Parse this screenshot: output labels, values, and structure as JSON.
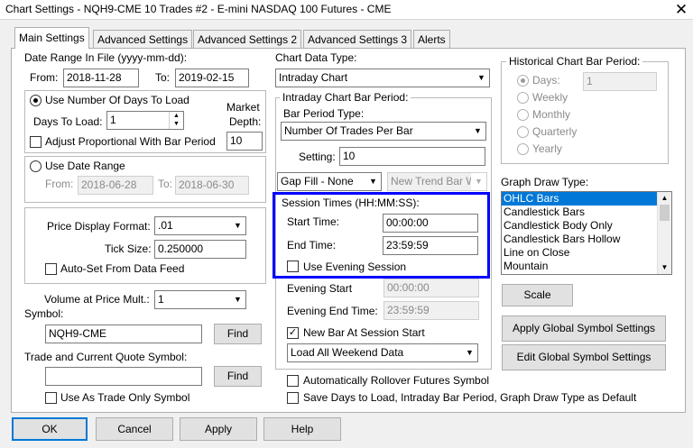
{
  "window": {
    "title": "Chart Settings - NQH9-CME  10 Trades  #2 - E-mini NASDAQ 100 Futures - CME",
    "close_glyph": "✕"
  },
  "tabs": [
    "Main Settings",
    "Advanced Settings",
    "Advanced Settings 2",
    "Advanced Settings 3",
    "Alerts"
  ],
  "date_range": {
    "label": "Date Range In File (yyyy-mm-dd):",
    "from_label": "From:",
    "from_value": "2018-11-28",
    "to_label": "To:",
    "to_value": "2019-02-15"
  },
  "days_group": {
    "use_days_label": "Use Number Of Days To Load",
    "use_days_selected": true,
    "days_to_load_label": "Days To Load:",
    "days_to_load_value": "1",
    "market_depth_label_1": "Market",
    "market_depth_label_2": "Depth:",
    "market_depth_value": "10",
    "adjust_label": "Adjust Proportional With Bar Period",
    "adjust_checked": false
  },
  "date_range_group": {
    "use_date_range_label": "Use Date Range",
    "use_date_range_selected": false,
    "from_label": "From:",
    "from_value": "2018-06-28",
    "to_label": "To:",
    "to_value": "2018-06-30"
  },
  "price_group": {
    "display_format_label": "Price Display Format:",
    "display_format_value": ".01",
    "tick_size_label": "Tick Size:",
    "tick_size_value": "0.250000",
    "auto_set_label": "Auto-Set From Data Feed",
    "auto_set_checked": false
  },
  "volume": {
    "label": "Volume at Price Mult.:",
    "value": "1"
  },
  "symbol": {
    "label": "Symbol:",
    "value": "NQH9-CME",
    "find_label": "Find"
  },
  "trade_symbol": {
    "label": "Trade and Current Quote Symbol:",
    "value": "",
    "find_label": "Find",
    "trade_only_label": "Use As Trade Only Symbol",
    "trade_only_checked": false
  },
  "chart_data_type": {
    "label": "Chart Data Type:",
    "value": "Intraday Chart"
  },
  "intraday": {
    "group_label": "Intraday Chart Bar Period:",
    "period_type_label": "Bar Period Type:",
    "period_type_value": "Number Of Trades Per Bar",
    "setting_label": "Setting:",
    "setting_value": "10",
    "gap_fill_value": "Gap Fill - None",
    "new_trend_value": "New Trend Bar W"
  },
  "session": {
    "group_label": "Session Times (HH:MM:SS):",
    "start_label": "Start Time:",
    "start_value": "00:00:00",
    "end_label": "End Time:",
    "end_value": "23:59:59",
    "evening_label": "Use Evening Session",
    "evening_checked": false,
    "evening_start_label": "Evening Start",
    "evening_start_value": "00:00:00",
    "evening_end_label": "Evening End Time:",
    "evening_end_value": "23:59:59",
    "new_bar_label": "New Bar At Session Start",
    "new_bar_checked": true,
    "weekend_value": "Load All Weekend Data"
  },
  "historical": {
    "group_label": "Historical Chart Bar Period:",
    "days_label": "Days:",
    "days_value": "1",
    "options": [
      "Weekly",
      "Monthly",
      "Quarterly",
      "Yearly"
    ]
  },
  "graph_draw": {
    "label": "Graph Draw Type:",
    "items": [
      "OHLC Bars",
      "Candlestick Bars",
      "Candlestick Body Only",
      "Candlestick Bars Hollow",
      "Line on Close",
      "Mountain"
    ],
    "selected_index": 0
  },
  "side_buttons": {
    "scale": "Scale",
    "apply_global": "Apply Global Symbol Settings",
    "edit_global": "Edit Global Symbol Settings"
  },
  "bottom_checks": {
    "rollover_label": "Automatically Rollover Futures Symbol",
    "rollover_checked": false,
    "save_default_label": "Save Days to Load, Intraday Bar Period, Graph Draw Type as Default",
    "save_default_checked": false
  },
  "footer": {
    "ok": "OK",
    "cancel": "Cancel",
    "apply": "Apply",
    "help": "Help"
  },
  "colors": {
    "highlight": "#0000ff",
    "selection": "#0078d7"
  }
}
